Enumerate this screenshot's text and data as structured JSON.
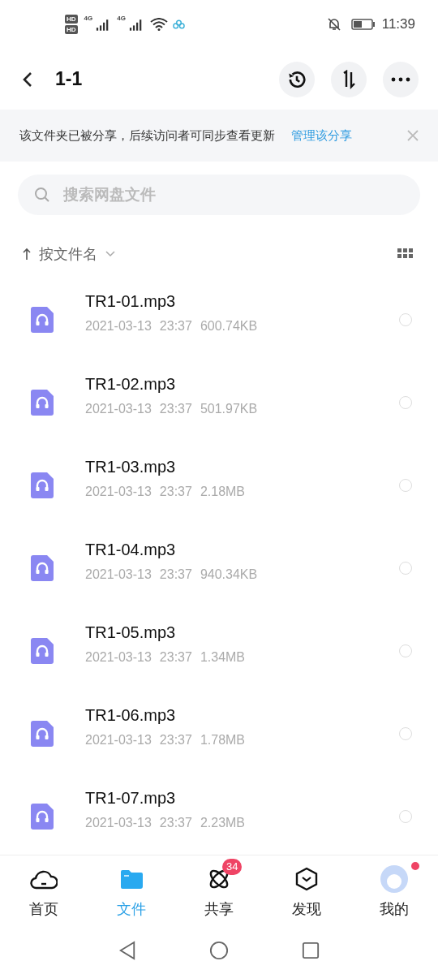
{
  "status_bar": {
    "sim_labels": [
      "HD",
      "HD"
    ],
    "network_labels": [
      "4G",
      "4G"
    ],
    "time": "11:39"
  },
  "header": {
    "title": "1-1"
  },
  "share_banner": {
    "text": "该文件夹已被分享，后续访问者可同步查看更新",
    "link": "管理该分享"
  },
  "search": {
    "placeholder": "搜索网盘文件"
  },
  "sort": {
    "label": "按文件名"
  },
  "files": [
    {
      "name": "TR1-01.mp3",
      "date": "2021-03-13",
      "time": "23:37",
      "size": "600.74KB",
      "selected": false
    },
    {
      "name": "TR1-02.mp3",
      "date": "2021-03-13",
      "time": "23:37",
      "size": "501.97KB",
      "selected": false
    },
    {
      "name": "TR1-03.mp3",
      "date": "2021-03-13",
      "time": "23:37",
      "size": "2.18MB",
      "selected": false
    },
    {
      "name": "TR1-04.mp3",
      "date": "2021-03-13",
      "time": "23:37",
      "size": "940.34KB",
      "selected": false
    },
    {
      "name": "TR1-05.mp3",
      "date": "2021-03-13",
      "time": "23:37",
      "size": "1.34MB",
      "selected": false
    },
    {
      "name": "TR1-06.mp3",
      "date": "2021-03-13",
      "time": "23:37",
      "size": "1.78MB",
      "selected": false
    },
    {
      "name": "TR1-07.mp3",
      "date": "2021-03-13",
      "time": "23:37",
      "size": "2.23MB",
      "selected": false
    }
  ],
  "tab_bar": [
    {
      "kind": "home",
      "label": "首页",
      "selected": false
    },
    {
      "kind": "files",
      "label": "文件",
      "selected": true
    },
    {
      "kind": "share",
      "label": "共享",
      "selected": false,
      "badge": "34"
    },
    {
      "kind": "discover",
      "label": "发现",
      "selected": false
    },
    {
      "kind": "profile",
      "label": "我的",
      "selected": false,
      "dot": true
    }
  ]
}
